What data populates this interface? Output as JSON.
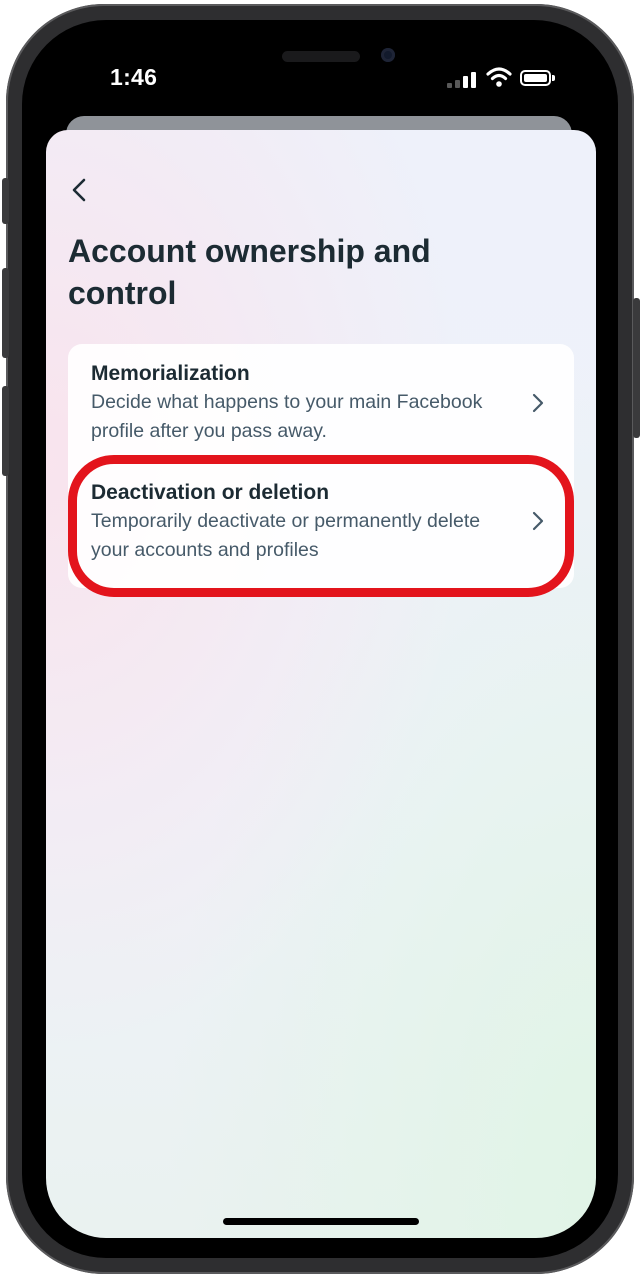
{
  "status_bar": {
    "time": "1:46"
  },
  "header": {
    "title": "Account ownership and control"
  },
  "items": [
    {
      "title": "Memorialization",
      "description": "Decide what happens to your main Facebook profile after you pass away."
    },
    {
      "title": "Deactivation or deletion",
      "description": "Temporarily deactivate or permanently delete your accounts and profiles"
    }
  ],
  "icons": {
    "back": "chevron-left-icon",
    "chevron": "chevron-right-icon",
    "signal": "cellular-signal-icon",
    "wifi": "wifi-icon",
    "battery": "battery-icon"
  },
  "colors": {
    "highlight": "#e3141c",
    "title_text": "#1c2b33",
    "description_text": "#465a69"
  }
}
